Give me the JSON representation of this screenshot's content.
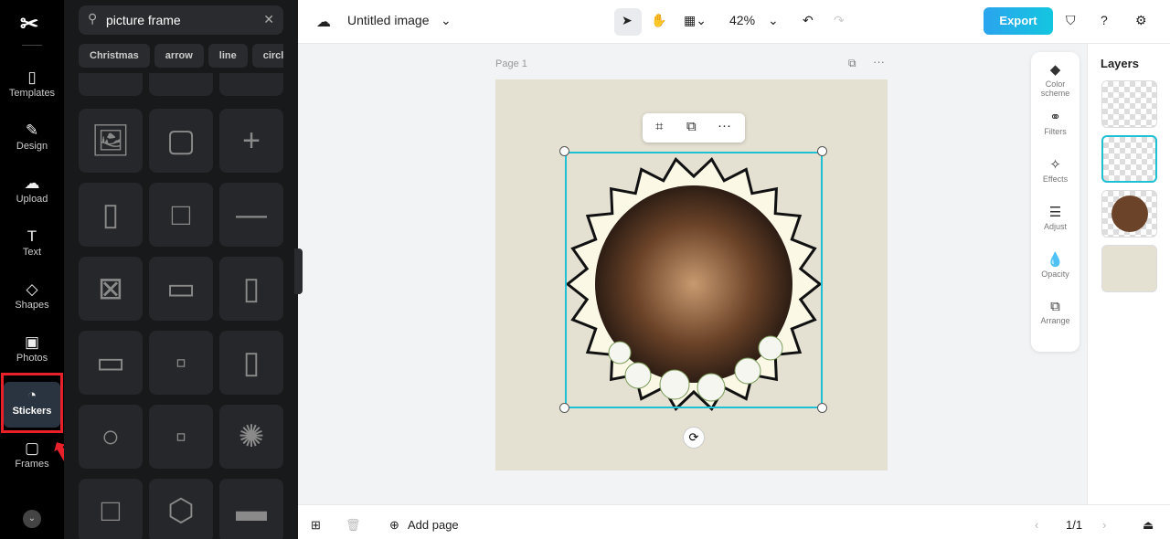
{
  "rail": {
    "items": [
      {
        "label": "Templates",
        "icon": "▯"
      },
      {
        "label": "Design",
        "icon": "✎"
      },
      {
        "label": "Upload",
        "icon": "☁"
      },
      {
        "label": "Text",
        "icon": "T"
      },
      {
        "label": "Shapes",
        "icon": "◇"
      },
      {
        "label": "Photos",
        "icon": "▣"
      },
      {
        "label": "Stickers",
        "icon": "◔"
      },
      {
        "label": "Frames",
        "icon": "▢"
      }
    ]
  },
  "search": {
    "value": "picture frame"
  },
  "chips": [
    "Christmas",
    "arrow",
    "line",
    "circle"
  ],
  "header": {
    "title": "Untitled image",
    "zoom": "42%",
    "export": "Export"
  },
  "page": {
    "label": "Page 1"
  },
  "tools": [
    {
      "label": "Color scheme",
      "icon": "◆"
    },
    {
      "label": "Filters",
      "icon": "⚭"
    },
    {
      "label": "Effects",
      "icon": "✧"
    },
    {
      "label": "Adjust",
      "icon": "☰"
    },
    {
      "label": "Opacity",
      "icon": "💧"
    },
    {
      "label": "Arrange",
      "icon": "⧉"
    }
  ],
  "layers": {
    "title": "Layers"
  },
  "footer": {
    "add_page": "Add page",
    "pagination": "1/1"
  },
  "colors": {
    "accent": "#13c6df",
    "highlight": "#e8202a"
  }
}
